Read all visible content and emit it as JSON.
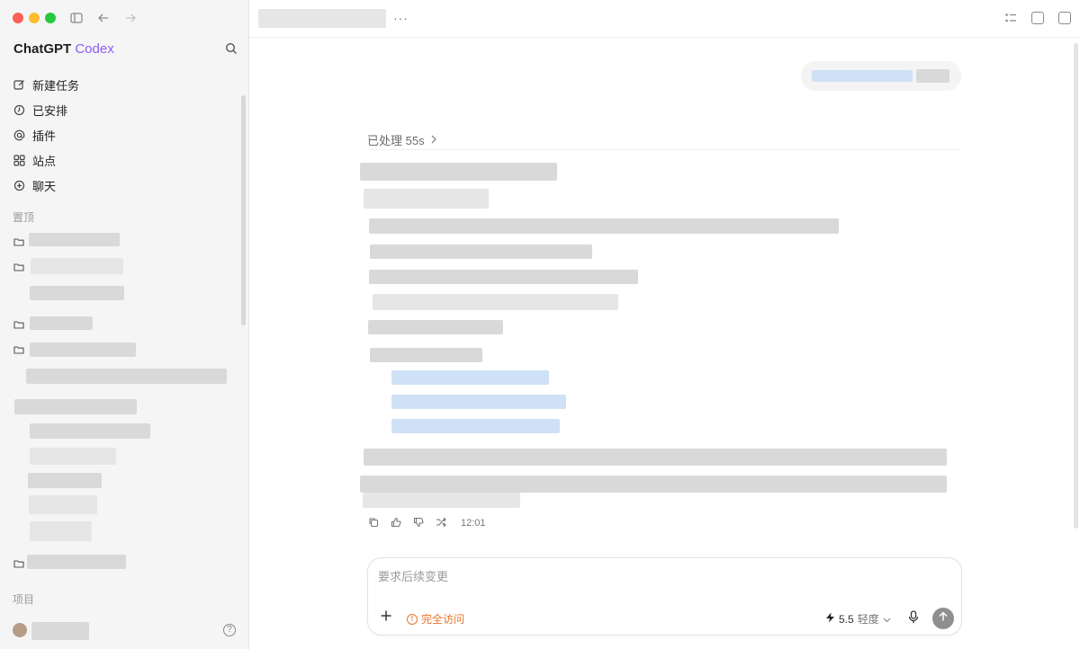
{
  "sidebar": {
    "brand": {
      "name": "ChatGPT",
      "accent": "Codex"
    },
    "nav": [
      {
        "label": "新建任务",
        "icon": "edit-icon"
      },
      {
        "label": "已安排",
        "icon": "clock-icon"
      },
      {
        "label": "插件",
        "icon": "at-icon"
      },
      {
        "label": "站点",
        "icon": "grid-icon"
      },
      {
        "label": "聊天",
        "icon": "plus-circle-icon"
      }
    ],
    "pinned_label": "置顶",
    "projects_label": "项目"
  },
  "main": {
    "processed_label": "已处理 55s",
    "message_time": "12:01",
    "composer": {
      "placeholder": "要求后续变更",
      "access_label": "完全访问",
      "model_version": "5.5",
      "model_effort": "轻度"
    }
  },
  "colors": {
    "accent": "#8b5cf6",
    "warning": "#e8742c",
    "traffic_red": "#fe5f57",
    "traffic_yellow": "#febc2e",
    "traffic_green": "#28c840"
  }
}
